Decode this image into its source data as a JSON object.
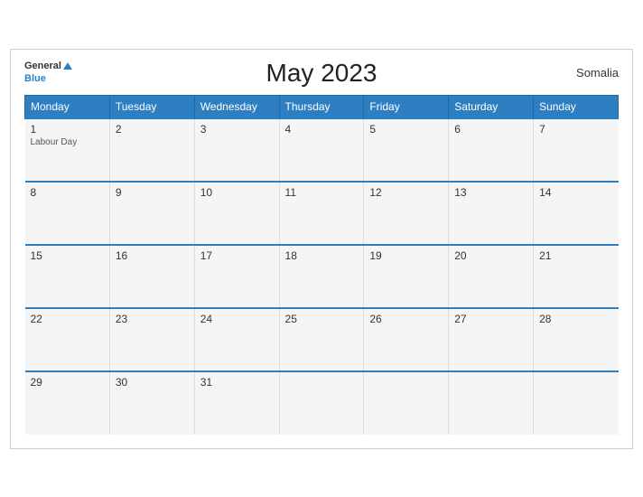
{
  "header": {
    "title": "May 2023",
    "country": "Somalia",
    "logo_general": "General",
    "logo_blue": "Blue"
  },
  "weekdays": [
    "Monday",
    "Tuesday",
    "Wednesday",
    "Thursday",
    "Friday",
    "Saturday",
    "Sunday"
  ],
  "weeks": [
    [
      {
        "day": "1",
        "event": "Labour Day"
      },
      {
        "day": "2",
        "event": ""
      },
      {
        "day": "3",
        "event": ""
      },
      {
        "day": "4",
        "event": ""
      },
      {
        "day": "5",
        "event": ""
      },
      {
        "day": "6",
        "event": ""
      },
      {
        "day": "7",
        "event": ""
      }
    ],
    [
      {
        "day": "8",
        "event": ""
      },
      {
        "day": "9",
        "event": ""
      },
      {
        "day": "10",
        "event": ""
      },
      {
        "day": "11",
        "event": ""
      },
      {
        "day": "12",
        "event": ""
      },
      {
        "day": "13",
        "event": ""
      },
      {
        "day": "14",
        "event": ""
      }
    ],
    [
      {
        "day": "15",
        "event": ""
      },
      {
        "day": "16",
        "event": ""
      },
      {
        "day": "17",
        "event": ""
      },
      {
        "day": "18",
        "event": ""
      },
      {
        "day": "19",
        "event": ""
      },
      {
        "day": "20",
        "event": ""
      },
      {
        "day": "21",
        "event": ""
      }
    ],
    [
      {
        "day": "22",
        "event": ""
      },
      {
        "day": "23",
        "event": ""
      },
      {
        "day": "24",
        "event": ""
      },
      {
        "day": "25",
        "event": ""
      },
      {
        "day": "26",
        "event": ""
      },
      {
        "day": "27",
        "event": ""
      },
      {
        "day": "28",
        "event": ""
      }
    ],
    [
      {
        "day": "29",
        "event": ""
      },
      {
        "day": "30",
        "event": ""
      },
      {
        "day": "31",
        "event": ""
      },
      {
        "day": "",
        "event": ""
      },
      {
        "day": "",
        "event": ""
      },
      {
        "day": "",
        "event": ""
      },
      {
        "day": "",
        "event": ""
      }
    ]
  ]
}
